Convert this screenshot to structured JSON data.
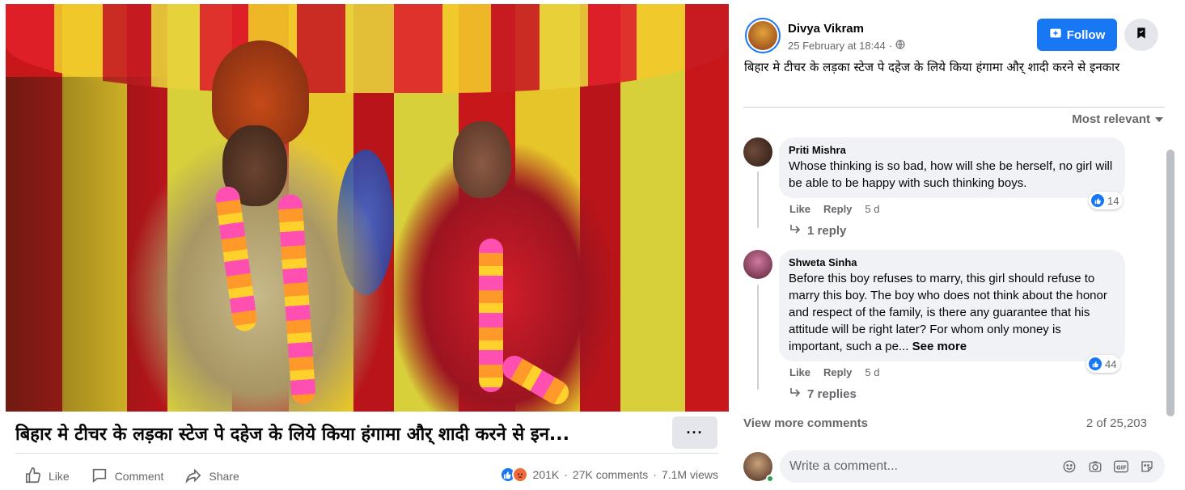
{
  "video": {
    "title": "बिहार मे टीचर के लड़का स्टेज पे दहेज के लिये किया हंगामा और् शादी करने से इन...",
    "more_label": "···"
  },
  "actions": {
    "like": "Like",
    "comment": "Comment",
    "share": "Share"
  },
  "stats": {
    "reactions": "201K",
    "comments": "27K comments",
    "views": "7.1M views",
    "separator": "·"
  },
  "post": {
    "author": "Divya Vikram",
    "date": "25 February at 18:44",
    "dot": "·",
    "follow_label": "Follow",
    "text": "बिहार मे टीचर के लड़का स्टेज पे दहेज के लिये किया हंगामा और् शादी करने से इनकार"
  },
  "sort": {
    "label": "Most relevant"
  },
  "comments": [
    {
      "name": "Priti Mishra",
      "text": "Whose thinking is so bad, how will she be herself, no girl will be able to be happy with such thinking boys.",
      "like": "Like",
      "reply": "Reply",
      "time": "5 d",
      "reactions": "14",
      "replies": "1 reply"
    },
    {
      "name": "Shweta Sinha",
      "text": "Before this boy refuses to marry, this girl should refuse to marry this boy. The boy who does not think about the honor and respect of the family, is there any guarantee that his attitude will be right later? For whom only money is important, such a pe...",
      "see_more": "See more",
      "like": "Like",
      "reply": "Reply",
      "time": "5 d",
      "reactions": "44",
      "replies": "7 replies"
    }
  ],
  "footer": {
    "view_more": "View more comments",
    "count": "2 of 25,203"
  },
  "composer": {
    "placeholder": "Write a comment..."
  },
  "colors": {
    "accent": "#1877f2",
    "angry": "#f0693a",
    "muted": "#65676b",
    "bubble": "#f0f2f5"
  }
}
